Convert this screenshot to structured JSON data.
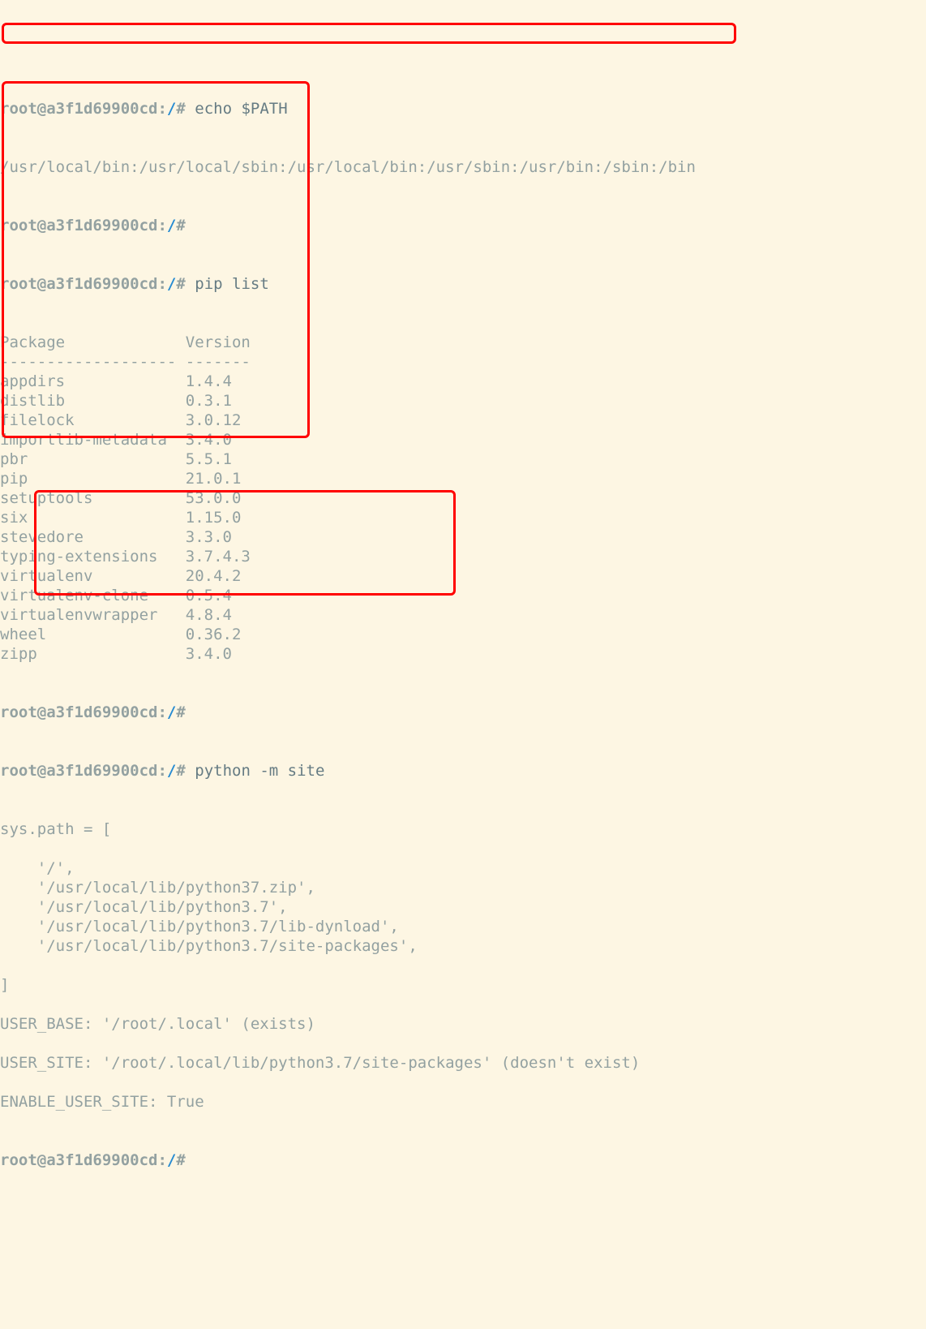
{
  "prompt": {
    "host": "root@a3f1d69900cd",
    "sep": ":",
    "path": "/",
    "ps": "#"
  },
  "cmds": {
    "echo_path": "echo $PATH",
    "pip_list": "pip list",
    "py_site": "python -m site"
  },
  "path_output": "/usr/local/bin:/usr/local/sbin:/usr/local/bin:/usr/sbin:/usr/bin:/sbin:/bin",
  "pip_header": {
    "pkg": "Package",
    "ver": "Version"
  },
  "pip_divider": "------------------- -------",
  "packages": [
    {
      "name": "appdirs",
      "ver": "1.4.4"
    },
    {
      "name": "distlib",
      "ver": "0.3.1"
    },
    {
      "name": "filelock",
      "ver": "3.0.12"
    },
    {
      "name": "importlib-metadata",
      "ver": "3.4.0"
    },
    {
      "name": "pbr",
      "ver": "5.5.1"
    },
    {
      "name": "pip",
      "ver": "21.0.1"
    },
    {
      "name": "setuptools",
      "ver": "53.0.0"
    },
    {
      "name": "six",
      "ver": "1.15.0"
    },
    {
      "name": "stevedore",
      "ver": "3.3.0"
    },
    {
      "name": "typing-extensions",
      "ver": "3.7.4.3"
    },
    {
      "name": "virtualenv",
      "ver": "20.4.2"
    },
    {
      "name": "virtualenv-clone",
      "ver": "0.5.4"
    },
    {
      "name": "virtualenvwrapper",
      "ver": "4.8.4"
    },
    {
      "name": "wheel",
      "ver": "0.36.2"
    },
    {
      "name": "zipp",
      "ver": "3.4.0"
    }
  ],
  "site": {
    "open": "sys.path = [",
    "entries": [
      "'/',",
      "'/usr/local/lib/python37.zip',",
      "'/usr/local/lib/python3.7',",
      "'/usr/local/lib/python3.7/lib-dynload',",
      "'/usr/local/lib/python3.7/site-packages',"
    ],
    "close": "]",
    "user_base": "USER_BASE: '/root/.local' (exists)",
    "user_site": "USER_SITE: '/root/.local/lib/python3.7/site-packages' (doesn't exist)",
    "enable": "ENABLE_USER_SITE: True"
  }
}
